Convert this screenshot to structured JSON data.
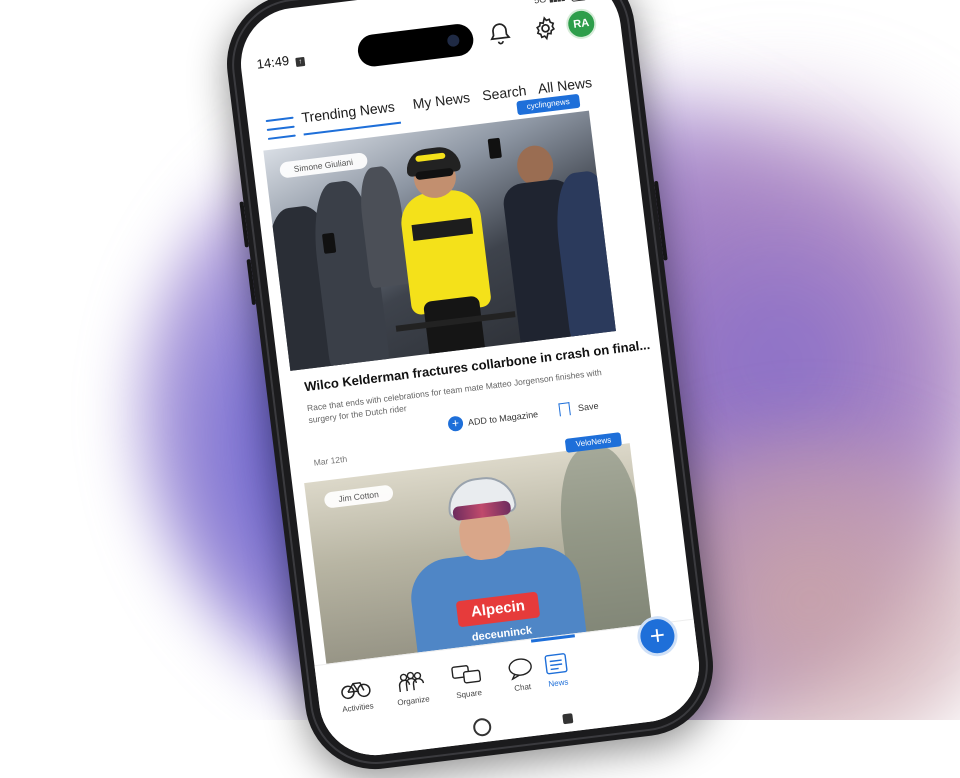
{
  "status": {
    "time": "14:49",
    "signal_text": "5G",
    "battery": "45"
  },
  "header": {
    "avatar_initials": "RA",
    "icons": [
      "bell-icon",
      "gear-icon"
    ]
  },
  "tabs": [
    {
      "label": "Trending News",
      "active": true
    },
    {
      "label": "My News",
      "active": false
    },
    {
      "label": "Search",
      "active": false
    },
    {
      "label": "All News",
      "active": false
    }
  ],
  "feed": {
    "cards": [
      {
        "source": "cyclingnews",
        "credit": "Simone Giuliani",
        "title": "Wilco Kelderman fractures collarbone in crash on final...",
        "description": "Race that ends with celebrations for team mate Matteo Jorgenson finishes with surgery for the Dutch rider",
        "add_label": "ADD to Magazine",
        "save_label": "Save",
        "date": "Mar 12th"
      },
      {
        "source": "VeloNews",
        "credit": "Jim Cotton",
        "jersey_text": "Alpecin",
        "jersey_subtext": "deceuninck"
      }
    ]
  },
  "bottom_nav": [
    {
      "label": "Activities",
      "icon": "bike-icon",
      "active": false
    },
    {
      "label": "Organize",
      "icon": "group-icon",
      "active": false
    },
    {
      "label": "Square",
      "icon": "square-chat-icon",
      "active": false
    },
    {
      "label": "Chat",
      "icon": "chat-icon",
      "active": false
    },
    {
      "label": "News",
      "icon": "news-icon",
      "active": true
    }
  ],
  "colors": {
    "accent": "#1e6fd9",
    "avatar": "#2e9e4b"
  }
}
